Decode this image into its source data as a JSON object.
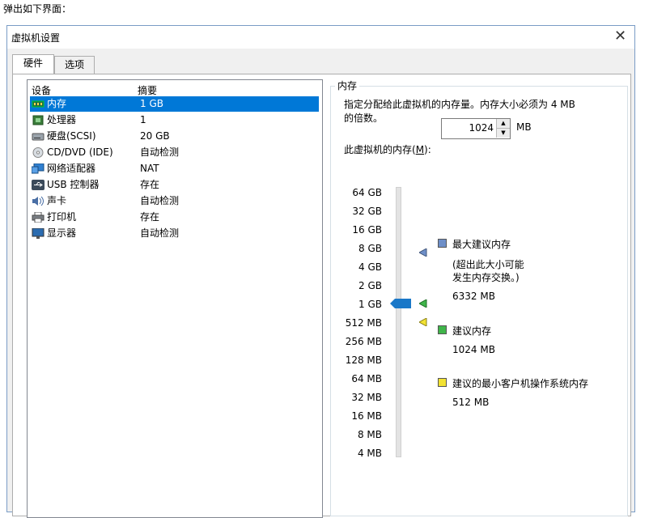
{
  "caption": "弹出如下界面：",
  "dialog": {
    "title": "虚拟机设置",
    "close_glyph": "✕"
  },
  "tabs": [
    {
      "label": "硬件",
      "active": true
    },
    {
      "label": "选项",
      "active": false
    }
  ],
  "device_list": {
    "col_device": "设备",
    "col_summary": "摘要",
    "rows": [
      {
        "name": "内存",
        "summary": "1 GB",
        "icon": "memory-icon",
        "selected": true
      },
      {
        "name": "处理器",
        "summary": "1",
        "icon": "processor-icon"
      },
      {
        "name": "硬盘(SCSI)",
        "summary": "20 GB",
        "icon": "harddisk-icon"
      },
      {
        "name": "CD/DVD (IDE)",
        "summary": "自动检测",
        "icon": "cdrom-icon"
      },
      {
        "name": "网络适配器",
        "summary": "NAT",
        "icon": "network-adapter-icon"
      },
      {
        "name": "USB 控制器",
        "summary": "存在",
        "icon": "usb-icon"
      },
      {
        "name": "声卡",
        "summary": "自动检测",
        "icon": "sound-card-icon"
      },
      {
        "name": "打印机",
        "summary": "存在",
        "icon": "printer-icon"
      },
      {
        "name": "显示器",
        "summary": "自动检测",
        "icon": "display-icon"
      }
    ]
  },
  "memory": {
    "group_label": "内存",
    "description_line1": "指定分配给此虚拟机的内存量。内存大小必须为 4 MB",
    "description_line2": "的倍数。",
    "input_label_pre": "此虚拟机的内存(",
    "input_label_key": "M",
    "input_label_post": "):",
    "value": "1024",
    "unit": "MB",
    "scale": [
      "64 GB",
      "32 GB",
      "16 GB",
      "8 GB",
      "4 GB",
      "2 GB",
      "1 GB",
      "512 MB",
      "256 MB",
      "128 MB",
      "64 MB",
      "32 MB",
      "16 MB",
      "8 MB",
      "4 MB"
    ],
    "max_recommended": {
      "label": "最大建议内存",
      "note1": "(超出此大小可能",
      "note2": "发生内存交换。)",
      "value": "6332 MB",
      "color": "#6e8fc8"
    },
    "recommended": {
      "label": "建议内存",
      "value": "1024 MB",
      "color": "#3fb54a"
    },
    "min_recommended": {
      "label": "建议的最小客户机操作系统内存",
      "value": "512 MB",
      "color": "#f2e233"
    },
    "thumb_color": "#1a78c8"
  }
}
